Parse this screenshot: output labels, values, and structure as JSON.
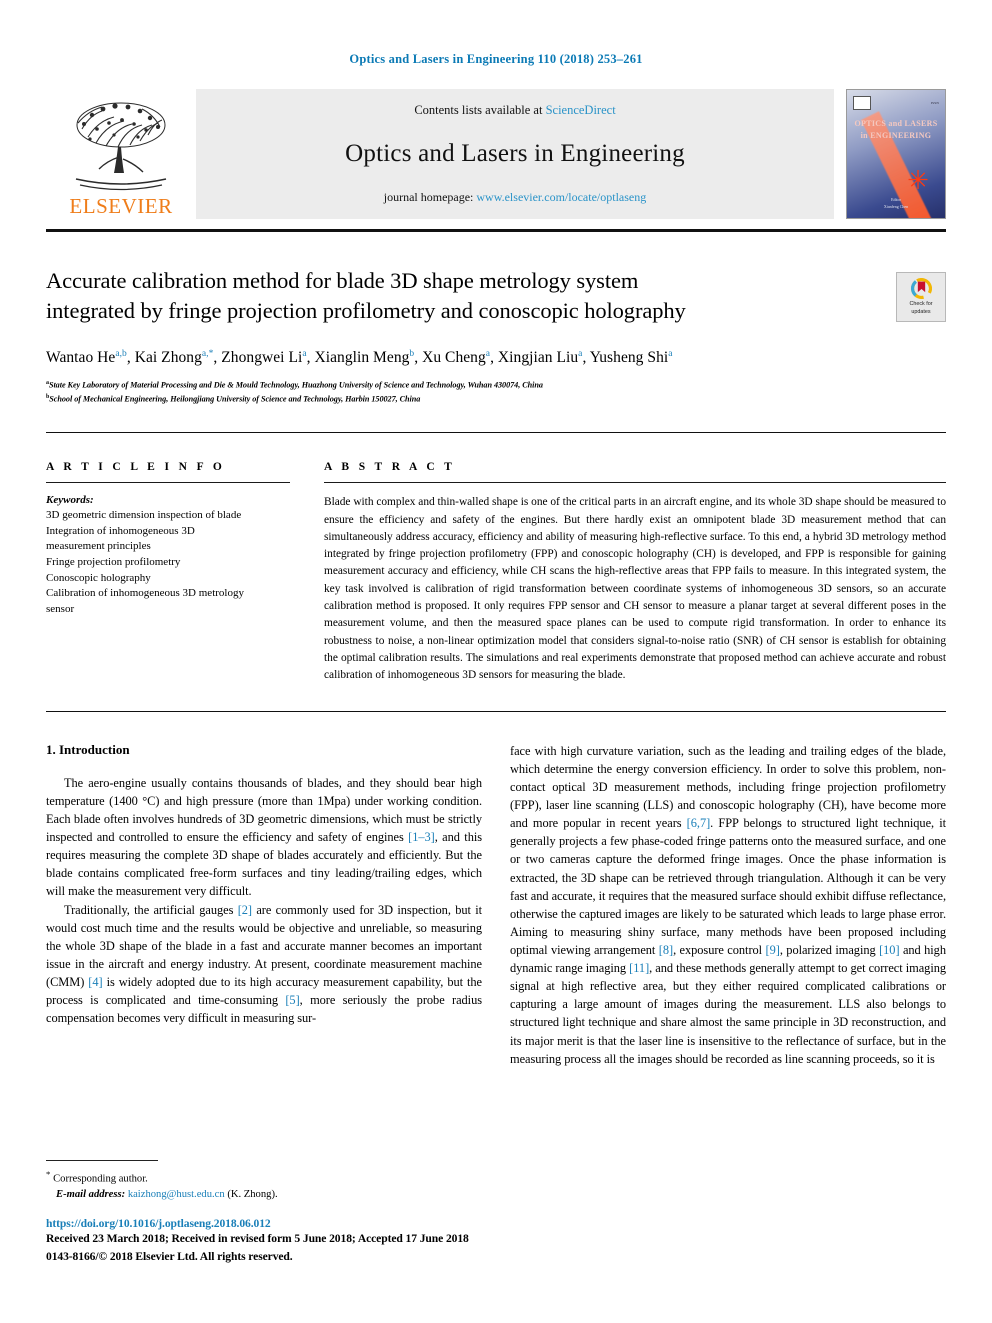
{
  "running_head": "Optics and Lasers in Engineering 110 (2018) 253–261",
  "masthead": {
    "publisher": "ELSEVIER",
    "contents_prefix": "Contents lists available at ",
    "contents_link": "ScienceDirect",
    "journal_name": "Optics and Lasers in Engineering",
    "homepage_prefix": "journal homepage: ",
    "homepage_url": "www.elsevier.com/locate/optlaseng",
    "cover": {
      "title_line1": "OPTICS and LASERS",
      "title_line2": "in ENGINEERING",
      "footer_line1": "Editor",
      "footer_line2": "Xianfeng Chen"
    }
  },
  "crossmark": {
    "line1": "Check for",
    "line2": "updates"
  },
  "article": {
    "title_line1": "Accurate calibration method for blade 3D shape metrology system",
    "title_line2": "integrated by fringe projection profilometry and conoscopic holography",
    "authors": [
      {
        "name": "Wantao He",
        "sup": "a,b",
        "sep": ", "
      },
      {
        "name": "Kai Zhong",
        "sup": "a,",
        "star": "*",
        "sep": ", "
      },
      {
        "name": "Zhongwei Li",
        "sup": "a",
        "sep": ", "
      },
      {
        "name": "Xianglin Meng",
        "sup": "b",
        "sep": ", "
      },
      {
        "name": "Xu Cheng",
        "sup": "a",
        "sep": ", "
      },
      {
        "name": "Xingjian Liu",
        "sup": "a",
        "sep": ", "
      },
      {
        "name": "Yusheng Shi",
        "sup": "a",
        "sep": ""
      }
    ],
    "affiliations": [
      {
        "marker": "a",
        "text": "State Key Laboratory of Material Processing and Die & Mould Technology, Huazhong University of Science and Technology, Wuhan 430074, China"
      },
      {
        "marker": "b",
        "text": "School of Mechanical Engineering, Heilongjiang University of Science and Technology, Harbin 150027, China"
      }
    ]
  },
  "article_info": {
    "heading": "A R T I C L E   I N F O",
    "keywords_label": "Keywords:",
    "keywords": [
      "3D geometric dimension inspection of blade",
      "Integration of inhomogeneous 3D",
      "measurement principles",
      "Fringe projection profilometry",
      "Conoscopic holography",
      "Calibration of inhomogeneous 3D metrology",
      "sensor"
    ]
  },
  "abstract": {
    "heading": "A B S T R A C T",
    "text": "Blade with complex and thin-walled shape is one of the critical parts in an aircraft engine, and its whole 3D shape should be measured to ensure the efficiency and safety of the engines. But there hardly exist an omnipotent blade 3D measurement method that can simultaneously address accuracy, efficiency and ability of measuring high-reflective surface. To this end, a hybrid 3D metrology method integrated by fringe projection profilometry (FPP) and conoscopic holography (CH) is developed, and FPP is responsible for gaining measurement accuracy and efficiency, while CH scans the high-reflective areas that FPP fails to measure. In this integrated system, the key task involved is calibration of rigid transformation between coordinate systems of inhomogeneous 3D sensors, so an accurate calibration method is proposed. It only requires FPP sensor and CH sensor to measure a planar target at several different poses in the measurement volume, and then the measured space planes can be used to compute rigid transformation. In order to enhance its robustness to noise, a non-linear optimization model that considers signal-to-noise ratio (SNR) of CH sensor is establish for obtaining the optimal calibration results. The simulations and real experiments demonstrate that proposed method can achieve accurate and robust calibration of inhomogeneous 3D sensors for measuring the blade."
  },
  "introduction": {
    "heading": "1. Introduction",
    "left_paragraphs": [
      {
        "segments": [
          {
            "t": "The aero-engine usually contains thousands of blades, and they should bear high temperature (1400 °C) and high pressure (more than 1Mpa) under working condition. Each blade often involves hundreds of 3D geometric dimensions, which must be strictly inspected and controlled to ensure the efficiency and safety of engines ",
            "ref": false
          },
          {
            "t": "[1–3]",
            "ref": true
          },
          {
            "t": ", and this requires measuring the complete 3D shape of blades accurately and efficiently. But the blade contains complicated free-form surfaces and tiny leading/trailing edges, which will make the measurement very difficult.",
            "ref": false
          }
        ]
      },
      {
        "segments": [
          {
            "t": "Traditionally, the artificial gauges ",
            "ref": false
          },
          {
            "t": "[2]",
            "ref": true
          },
          {
            "t": " are commonly used for 3D inspection, but it would cost much time and the results would be objective and unreliable, so measuring the whole 3D shape of the blade in a fast and accurate manner becomes an important issue in the aircraft and energy industry. At present, coordinate measurement machine (CMM) ",
            "ref": false
          },
          {
            "t": "[4]",
            "ref": true
          },
          {
            "t": " is widely adopted due to its high accuracy measurement capability, but the process is complicated and time-consuming ",
            "ref": false
          },
          {
            "t": "[5]",
            "ref": true
          },
          {
            "t": ", more seriously the probe radius compensation becomes very difficult in measuring sur-",
            "ref": false
          }
        ]
      }
    ],
    "right_paragraphs": [
      {
        "segments": [
          {
            "t": "face with high curvature variation, such as the leading and trailing edges of the blade, which determine the energy conversion efficiency. In order to solve this problem, non-contact optical 3D measurement methods, including fringe projection profilometry (FPP), laser line scanning (LLS) and conoscopic holography (CH), have become more and more popular in recent years ",
            "ref": false
          },
          {
            "t": "[6,7]",
            "ref": true
          },
          {
            "t": ". FPP belongs to structured light technique, it generally projects a few phase-coded fringe patterns onto the measured surface, and one or two cameras capture the deformed fringe images. Once the phase information is extracted, the 3D shape can be retrieved through triangulation. Although it can be very fast and accurate, it requires that the measured surface should exhibit diffuse reflectance, otherwise the captured images are likely to be saturated which leads to large phase error. Aiming to measuring shiny surface, many methods have been proposed including optimal viewing arrangement ",
            "ref": false
          },
          {
            "t": "[8]",
            "ref": true
          },
          {
            "t": ", exposure control ",
            "ref": false
          },
          {
            "t": "[9]",
            "ref": true
          },
          {
            "t": ", polarized imaging ",
            "ref": false
          },
          {
            "t": "[10]",
            "ref": true
          },
          {
            "t": " and high dynamic range imaging ",
            "ref": false
          },
          {
            "t": "[11]",
            "ref": true
          },
          {
            "t": ", and these methods generally attempt to get correct imaging signal at high reflective area, but they either required complicated calibrations or capturing a large amount of images during the measurement. LLS also belongs to structured light technique and share almost the same principle in 3D reconstruction, and its major merit is that the laser line is insensitive to the reflectance of surface, but in the measuring process all the images should be recorded as line scanning proceeds, so it is",
            "ref": false
          }
        ]
      }
    ]
  },
  "footnotes": {
    "corresponding_marker": "*",
    "corresponding": "Corresponding author.",
    "email_label": "E-mail address:",
    "email": "kaizhong@hust.edu.cn",
    "email_suffix": "(K. Zhong).",
    "doi": "https://doi.org/10.1016/j.optlaseng.2018.06.012",
    "history": "Received 23 March 2018; Received in revised form 5 June 2018; Accepted 17 June 2018",
    "copyright": "0143-8166/© 2018 Elsevier Ltd. All rights reserved."
  },
  "colors": {
    "link": "#1a7fb8",
    "elsevier_orange": "#ef7d1a",
    "masthead_bg": "#ececec"
  }
}
